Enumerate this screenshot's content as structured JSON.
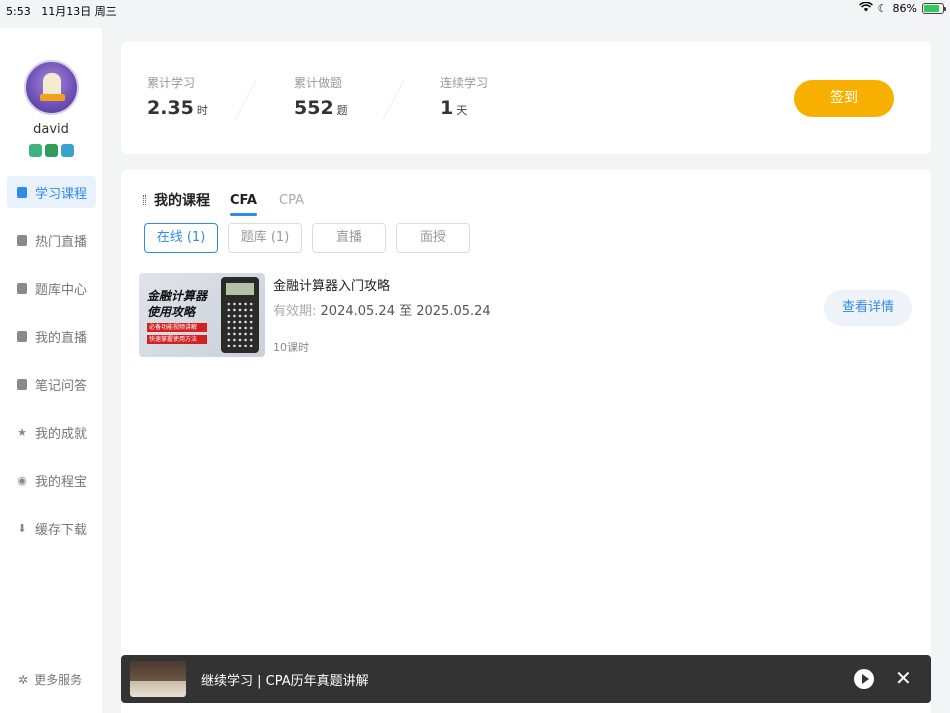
{
  "status_bar": {
    "time": "5:53",
    "date": "11月13日 周三",
    "battery": "86%"
  },
  "sidebar": {
    "username": "david",
    "items": [
      {
        "label": "学习课程",
        "icon": "book-icon",
        "active": true
      },
      {
        "label": "热门直播",
        "icon": "live-icon",
        "active": false
      },
      {
        "label": "题库中心",
        "icon": "question-bank-icon",
        "active": false
      },
      {
        "label": "我的直播",
        "icon": "my-live-icon",
        "active": false
      },
      {
        "label": "笔记问答",
        "icon": "notes-icon",
        "active": false
      },
      {
        "label": "我的成就",
        "icon": "star-icon",
        "active": false
      },
      {
        "label": "我的程宝",
        "icon": "coin-icon",
        "active": false
      },
      {
        "label": "缓存下载",
        "icon": "download-icon",
        "active": false
      }
    ],
    "more_label": "更多服务"
  },
  "stats": {
    "study": {
      "label": "累计学习",
      "value": "2.35",
      "unit": "时"
    },
    "questions": {
      "label": "累计做题",
      "value": "552",
      "unit": "题"
    },
    "streak": {
      "label": "连续学习",
      "value": "1",
      "unit": "天"
    },
    "checkin_label": "签到"
  },
  "courses": {
    "title": "我的课程",
    "tabs": [
      "CFA",
      "CPA"
    ],
    "active_tab": "CFA",
    "filters": [
      "在线 (1)",
      "题库 (1)",
      "直播",
      "面授"
    ],
    "items": [
      {
        "title": "金融计算器入门攻略",
        "valid_label": "有效期:",
        "valid_value": "2024.05.24 至 2025.05.24",
        "lessons": "10课时",
        "detail_label": "查看详情",
        "thumb": {
          "line1": "金融计算器",
          "line2": "使用攻略",
          "tag1": "必备功能视频讲解",
          "tag2": "快速掌握使用方法"
        }
      }
    ]
  },
  "continue_bar": {
    "text": "继续学习 | CPA历年真题讲解"
  },
  "colors": {
    "accent": "#2f8be6",
    "checkin": "#f8b000"
  }
}
